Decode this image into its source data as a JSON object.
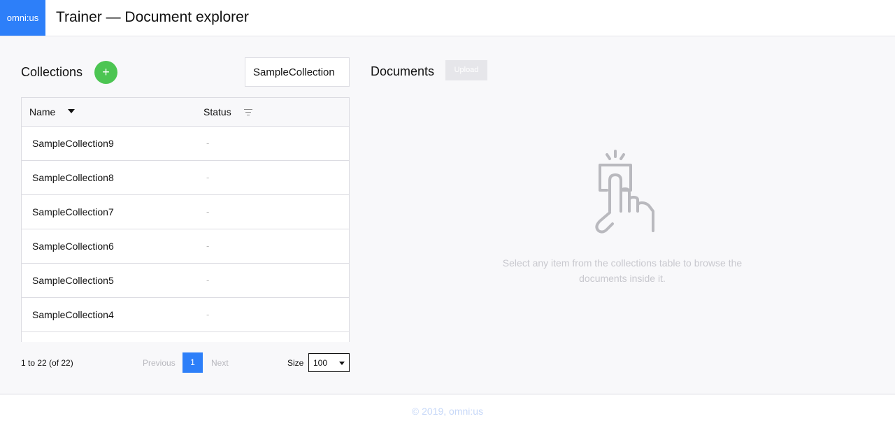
{
  "header": {
    "logo_text": "omni:us",
    "title": "Trainer — Document explorer",
    "logo_color": "#2d7ff9"
  },
  "collections": {
    "title": "Collections",
    "add_button_label": "+",
    "search_value": "SampleCollection",
    "columns": {
      "name": "Name",
      "status": "Status"
    },
    "rows": [
      {
        "name": "SampleCollection9",
        "status": "-"
      },
      {
        "name": "SampleCollection8",
        "status": "-"
      },
      {
        "name": "SampleCollection7",
        "status": "-"
      },
      {
        "name": "SampleCollection6",
        "status": "-"
      },
      {
        "name": "SampleCollection5",
        "status": "-"
      },
      {
        "name": "SampleCollection4",
        "status": "-"
      }
    ]
  },
  "pagination": {
    "summary": "1 to 22 (of 22)",
    "previous_label": "Previous",
    "current_page": "1",
    "next_label": "Next",
    "size_label": "Size",
    "size_value": "100"
  },
  "documents": {
    "title": "Documents",
    "upload_label": "Upload",
    "empty_icon": "tap-hand-icon",
    "empty_message": "Select any item from the collections table to browse the documents inside it."
  },
  "footer": {
    "text": "© 2019, omni:us"
  },
  "colors": {
    "accent": "#2d7ff9",
    "add_button": "#4cc552"
  }
}
